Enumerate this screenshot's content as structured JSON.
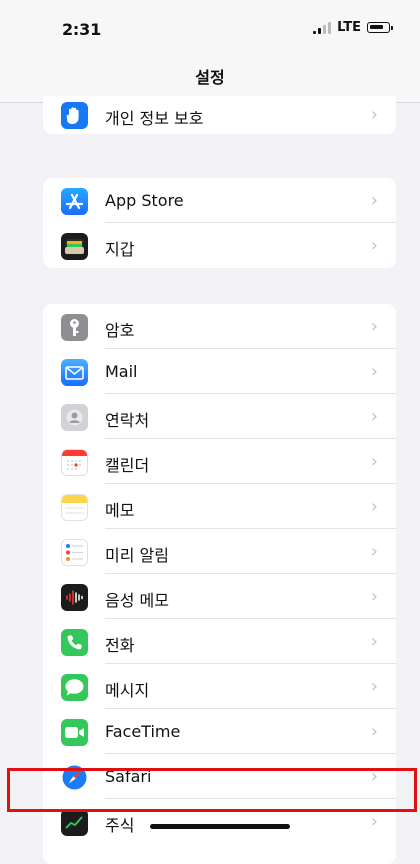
{
  "status": {
    "time": "2:31",
    "network": "LTE"
  },
  "nav": {
    "title": "설정"
  },
  "groups": [
    {
      "items": [
        {
          "label": "개인 정보 보호",
          "icon": "hand-icon",
          "color": "#1877f2"
        }
      ]
    },
    {
      "items": [
        {
          "label": "App Store",
          "icon": "app-store-icon",
          "color": "#1a8cff"
        },
        {
          "label": "지갑",
          "icon": "wallet-icon",
          "color": "#1c1c1e"
        }
      ]
    },
    {
      "items": [
        {
          "label": "암호",
          "icon": "key-icon",
          "color": "#8e8e93"
        },
        {
          "label": "Mail",
          "icon": "mail-icon",
          "color": "#2f8cff"
        },
        {
          "label": "연락처",
          "icon": "contacts-icon",
          "color": "#c8c8cc"
        },
        {
          "label": "캘린더",
          "icon": "calendar-icon",
          "color": "#ffffff"
        },
        {
          "label": "메모",
          "icon": "notes-icon",
          "color": "#fbd54a"
        },
        {
          "label": "미리 알림",
          "icon": "reminders-icon",
          "color": "#ffffff"
        },
        {
          "label": "음성 메모",
          "icon": "voice-memo-icon",
          "color": "#1c1c1e"
        },
        {
          "label": "전화",
          "icon": "phone-icon",
          "color": "#34c759"
        },
        {
          "label": "메시지",
          "icon": "messages-icon",
          "color": "#34c759"
        },
        {
          "label": "FaceTime",
          "icon": "facetime-icon",
          "color": "#34c759"
        },
        {
          "label": "Safari",
          "icon": "safari-icon",
          "color": "#1c7cf5"
        },
        {
          "label": "주식",
          "icon": "stocks-icon",
          "color": "#1c1c1e"
        }
      ]
    }
  ]
}
